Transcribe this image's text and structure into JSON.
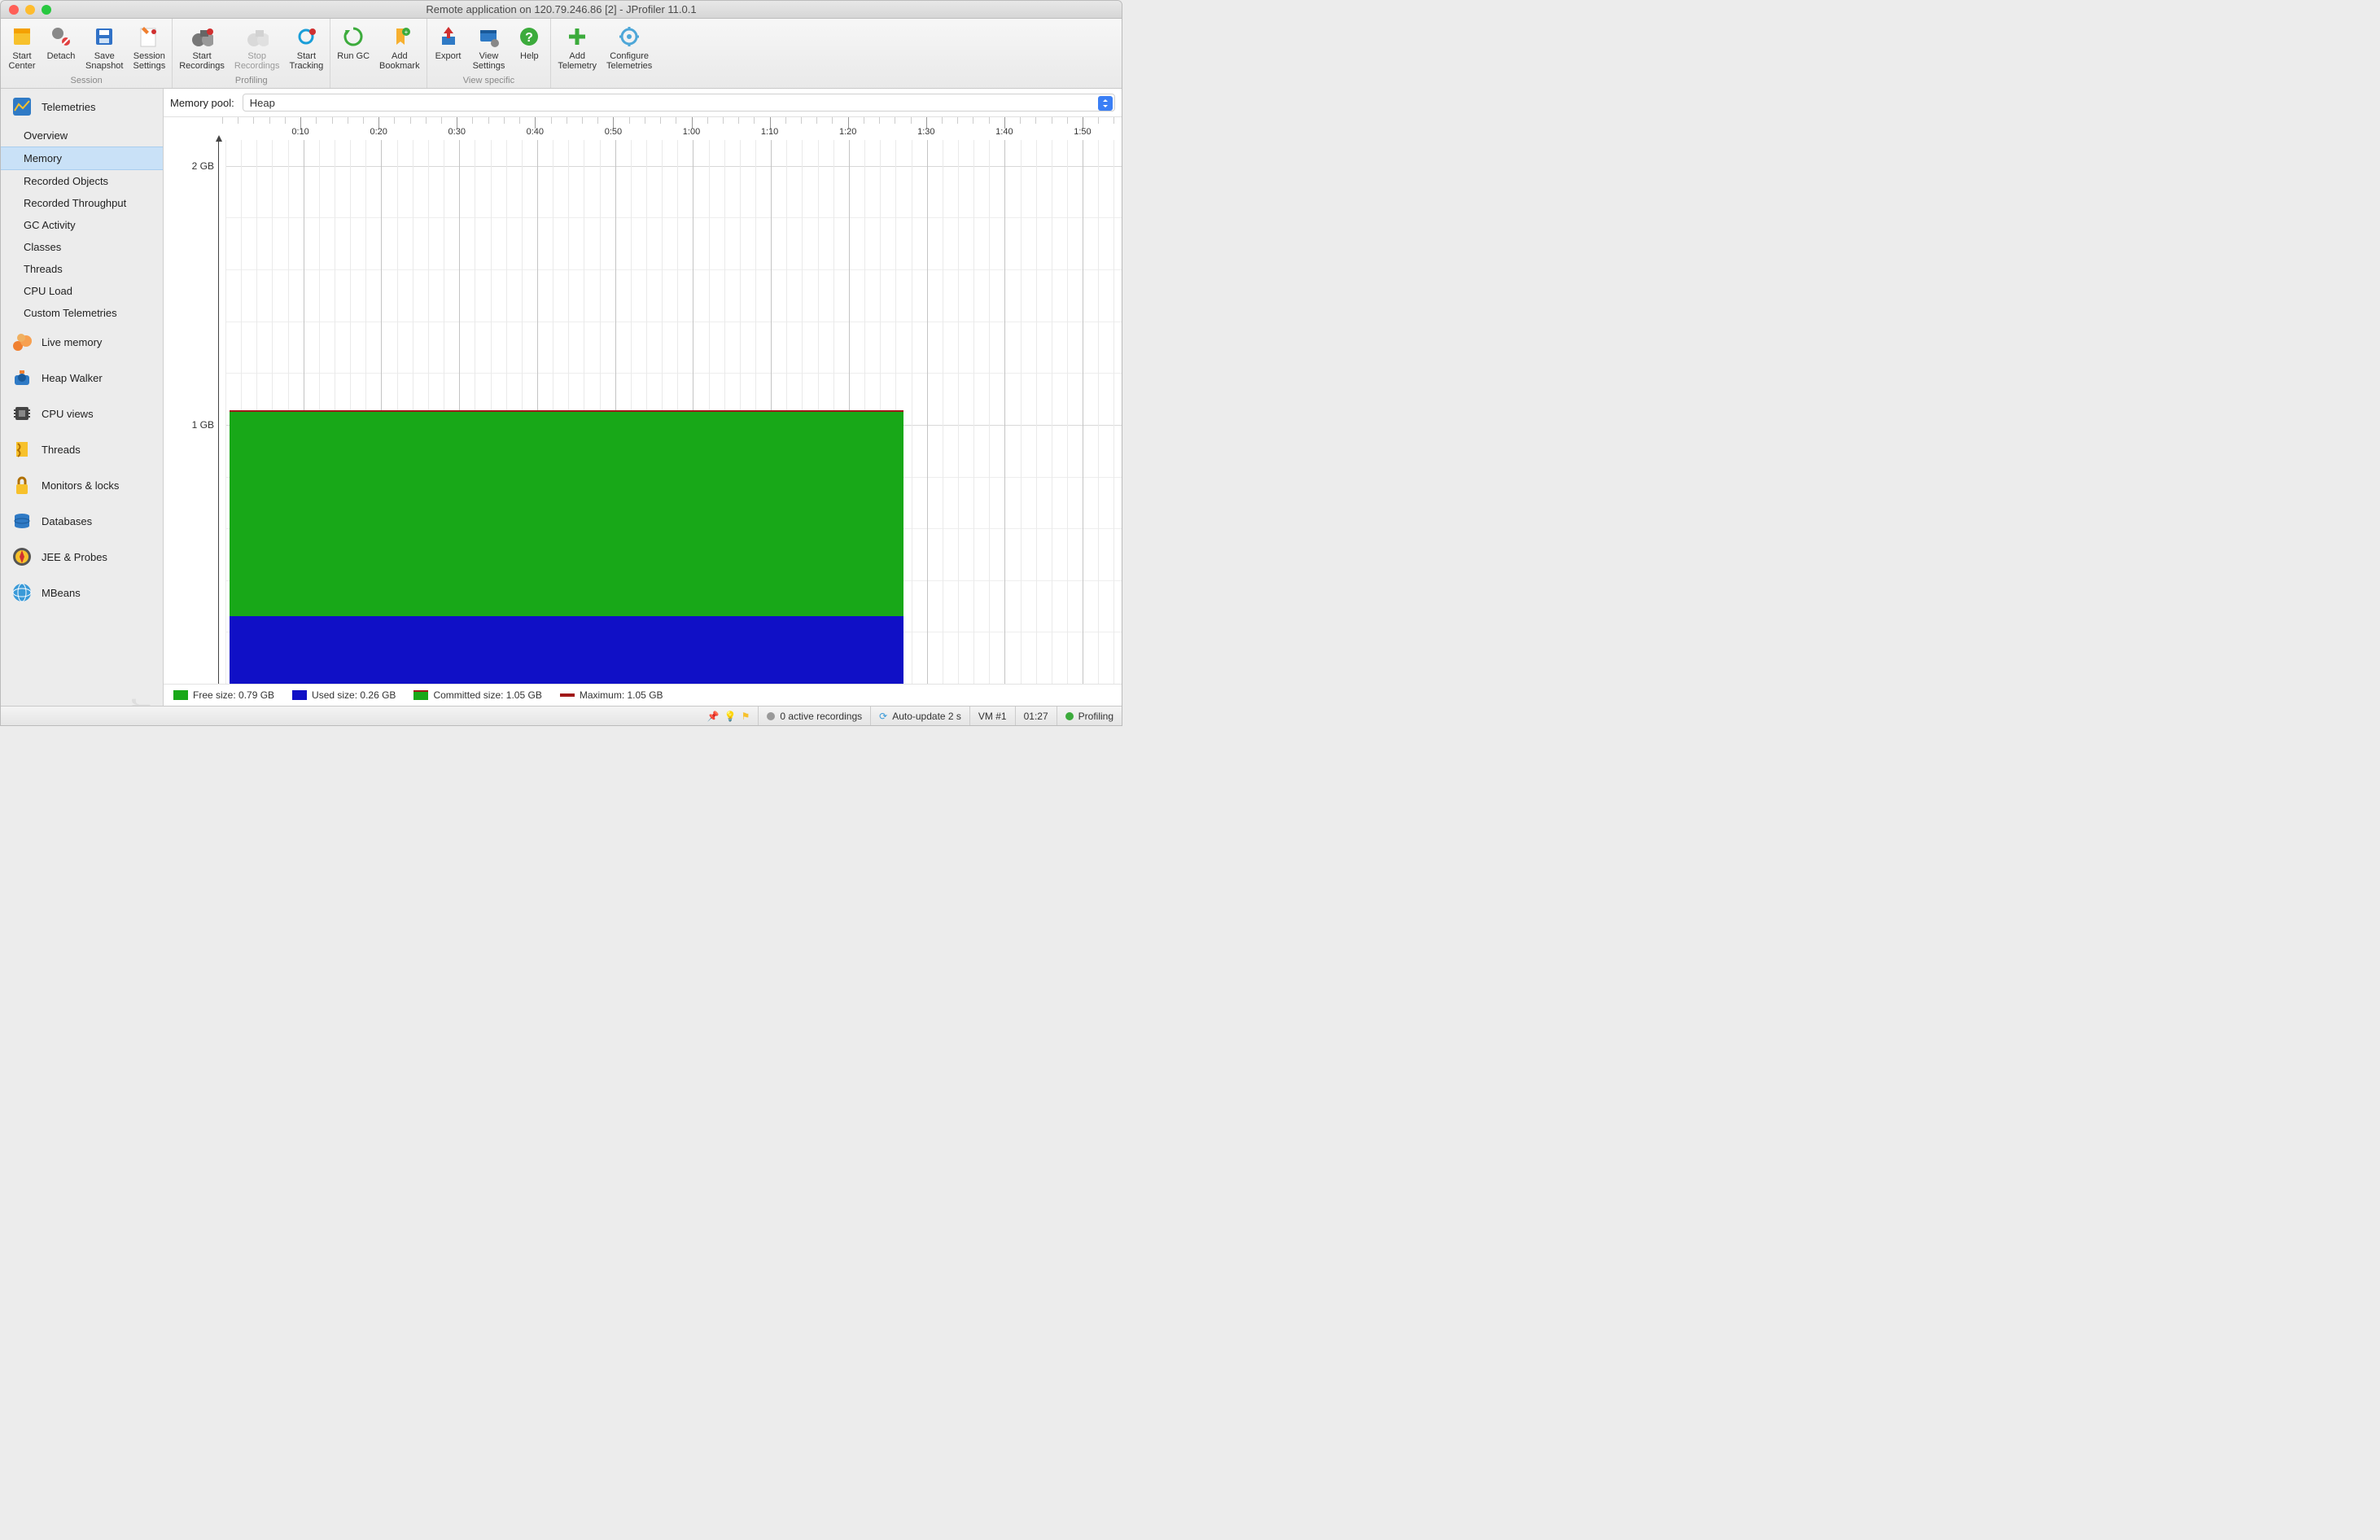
{
  "window": {
    "title": "Remote application on 120.79.246.86 [2] - JProfiler 11.0.1"
  },
  "toolbar": {
    "groups": [
      {
        "label": "Session",
        "buttons": [
          "Start\nCenter",
          "Detach",
          "Save\nSnapshot",
          "Session\nSettings"
        ]
      },
      {
        "label": "Profiling",
        "buttons": [
          "Start\nRecordings",
          "Stop\nRecordings",
          "Start\nTracking"
        ]
      },
      {
        "label": "",
        "buttons": [
          "Run GC",
          "Add\nBookmark"
        ]
      },
      {
        "label": "View specific",
        "buttons": [
          "Export",
          "View\nSettings",
          "Help"
        ]
      },
      {
        "label": "",
        "buttons": [
          "Add\nTelemetry",
          "Configure\nTelemetries"
        ]
      }
    ]
  },
  "sidebar": {
    "sections": [
      {
        "title": "Telemetries",
        "items": [
          "Overview",
          "Memory",
          "Recorded Objects",
          "Recorded Throughput",
          "GC Activity",
          "Classes",
          "Threads",
          "CPU Load",
          "Custom Telemetries"
        ],
        "selected": 1
      },
      {
        "title": "Live memory",
        "items": []
      },
      {
        "title": "Heap Walker",
        "items": []
      },
      {
        "title": "CPU views",
        "items": []
      },
      {
        "title": "Threads",
        "items": []
      },
      {
        "title": "Monitors & locks",
        "items": []
      },
      {
        "title": "Databases",
        "items": []
      },
      {
        "title": "JEE & Probes",
        "items": []
      },
      {
        "title": "MBeans",
        "items": []
      }
    ],
    "watermark": "JProfiler"
  },
  "pool": {
    "label": "Memory pool:",
    "value": "Heap"
  },
  "legend": {
    "free": "Free size: 0.79 GB",
    "used": "Used size: 0.26 GB",
    "committed": "Committed size: 1.05 GB",
    "max": "Maximum: 1.05 GB"
  },
  "status": {
    "recordings": "0 active recordings",
    "autoupdate": "Auto-update 2 s",
    "vm": "VM #1",
    "clock": "01:27",
    "state": "Profiling"
  },
  "chart_data": {
    "type": "area",
    "title": "",
    "xlabel": "",
    "ylabel": "",
    "x_unit": "mm:ss",
    "y_unit": "GB",
    "ylim": [
      0,
      2.1
    ],
    "y_ticks": [
      {
        "v": 1.0,
        "label": "1 GB"
      },
      {
        "v": 2.0,
        "label": "2 GB"
      }
    ],
    "x_ticks_seconds": [
      10,
      20,
      30,
      40,
      50,
      60,
      70,
      80,
      90,
      100,
      110
    ],
    "x_tick_labels": [
      "0:10",
      "0:20",
      "0:30",
      "0:40",
      "0:50",
      "1:00",
      "1:10",
      "1:20",
      "1:30",
      "1:40",
      "1:50"
    ],
    "x_range_seconds": [
      0,
      115
    ],
    "series": [
      {
        "name": "Used size",
        "value_gb": 0.26,
        "stack_order": 0,
        "color": "#1010c6"
      },
      {
        "name": "Free size",
        "value_gb": 0.79,
        "stack_order": 1,
        "color": "#18a818"
      },
      {
        "name": "Committed size",
        "value_gb": 1.05,
        "type": "derived-sum",
        "color": "#18a818"
      },
      {
        "name": "Maximum",
        "value_gb": 1.05,
        "type": "line",
        "color": "#a01818"
      }
    ],
    "data_extent_seconds": [
      0.5,
      87
    ]
  }
}
